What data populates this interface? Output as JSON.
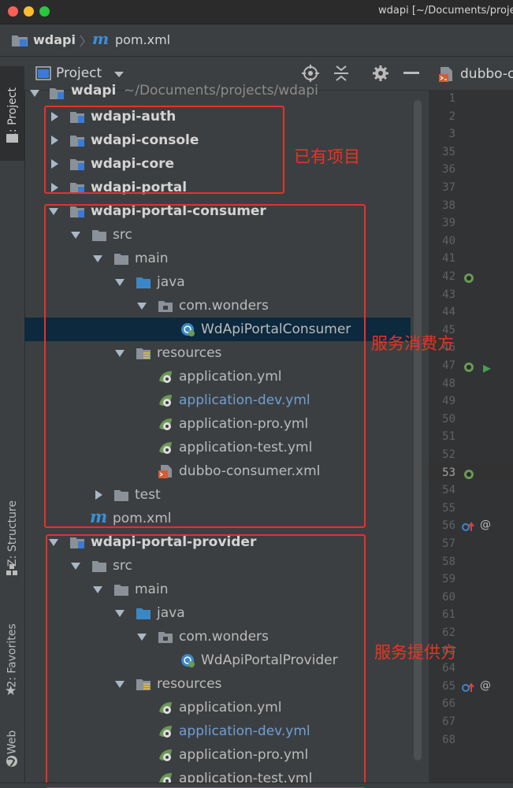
{
  "window": {
    "title": "wdapi [~/Documents/proje",
    "traffic_lights": [
      "#fe5f57",
      "#febc2e",
      "#28c840"
    ]
  },
  "breadcrumb": {
    "project": "wdapi",
    "file": "pom.xml"
  },
  "tool_windows": {
    "project_tab": "1: Project",
    "structure_tab": "Z: Structure",
    "favorites_tab": "2: Favorites",
    "web_tab": "Web"
  },
  "project_panel": {
    "title": "Project",
    "root": {
      "name": "wdapi",
      "path": "~/Documents/projects/wdapi"
    },
    "tree": [
      {
        "label": "wdapi-auth",
        "bold": true
      },
      {
        "label": "wdapi-console",
        "bold": true
      },
      {
        "label": "wdapi-core",
        "bold": true
      },
      {
        "label": "wdapi-portal",
        "bold": true
      },
      {
        "label": "wdapi-portal-consumer",
        "bold": true
      },
      {
        "label": "src"
      },
      {
        "label": "main"
      },
      {
        "label": "java"
      },
      {
        "label": "com.wonders"
      },
      {
        "label": "WdApiPortalConsumer",
        "selected": true
      },
      {
        "label": "resources"
      },
      {
        "label": "application.yml"
      },
      {
        "label": "application-dev.yml",
        "modified": true
      },
      {
        "label": "application-pro.yml"
      },
      {
        "label": "application-test.yml"
      },
      {
        "label": "dubbo-consumer.xml"
      },
      {
        "label": "test"
      },
      {
        "label": "pom.xml"
      },
      {
        "label": "wdapi-portal-provider",
        "bold": true
      },
      {
        "label": "src"
      },
      {
        "label": "main"
      },
      {
        "label": "java"
      },
      {
        "label": "com.wonders"
      },
      {
        "label": "WdApiPortalProvider"
      },
      {
        "label": "resources"
      },
      {
        "label": "application.yml"
      },
      {
        "label": "application-dev.yml",
        "modified": true
      },
      {
        "label": "application-pro.yml"
      },
      {
        "label": "application-test.yml"
      }
    ]
  },
  "editor": {
    "tab_label": "dubbo-c",
    "line_numbers": [
      "1",
      "2",
      "3",
      "35",
      "36",
      "37",
      "38",
      "39",
      "40",
      "41",
      "42",
      "43",
      "44",
      "45",
      "46",
      "47",
      "48",
      "49",
      "50",
      "51",
      "52",
      "53",
      "54",
      "55",
      "56",
      "57",
      "58",
      "59",
      "60",
      "61",
      "62",
      "63",
      "64",
      "65",
      "66",
      "67",
      "68"
    ],
    "current_line": "53",
    "at_marker": "@"
  },
  "annotations": {
    "existing_projects": "已有项目",
    "service_consumer": "服务消费方",
    "service_provider": "服务提供方",
    "color": "#e5312b"
  }
}
